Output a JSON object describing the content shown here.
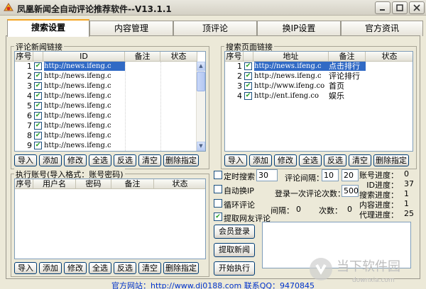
{
  "window": {
    "title": "凤凰新闻全自动评论推荐软件--V13.1.1"
  },
  "tabs": [
    {
      "label": "搜索设置",
      "active": true
    },
    {
      "label": "内容管理",
      "active": false
    },
    {
      "label": "顶评论",
      "active": false
    },
    {
      "label": "换IP设置",
      "active": false
    },
    {
      "label": "官方资讯",
      "active": false
    }
  ],
  "comment_links": {
    "title": "评论新闻链接",
    "headers": [
      "序号",
      "ID",
      "备注",
      "状态"
    ],
    "rows": [
      {
        "num": "1",
        "id": "http://news.ifeng.c",
        "note": "",
        "status": "",
        "checked": true
      },
      {
        "num": "2",
        "id": "http://news.ifeng.c",
        "note": "",
        "status": "",
        "checked": true
      },
      {
        "num": "3",
        "id": "http://news.ifeng.c",
        "note": "",
        "status": "",
        "checked": true
      },
      {
        "num": "4",
        "id": "http://news.ifeng.c",
        "note": "",
        "status": "",
        "checked": true
      },
      {
        "num": "5",
        "id": "http://news.ifeng.c",
        "note": "",
        "status": "",
        "checked": true
      },
      {
        "num": "6",
        "id": "http://news.ifeng.c",
        "note": "",
        "status": "",
        "checked": true
      },
      {
        "num": "7",
        "id": "http://news.ifeng.c",
        "note": "",
        "status": "",
        "checked": true
      },
      {
        "num": "8",
        "id": "http://news.ifeng.c",
        "note": "",
        "status": "",
        "checked": true
      },
      {
        "num": "9",
        "id": "http://news.ifeng.c",
        "note": "",
        "status": "",
        "checked": true
      }
    ]
  },
  "search_links": {
    "title": "搜索页面链接",
    "headers": [
      "序号",
      "地址",
      "备注",
      "状态"
    ],
    "rows": [
      {
        "num": "1",
        "addr": "http://news.ifeng.c",
        "note": "点击排行",
        "status": "",
        "checked": true
      },
      {
        "num": "2",
        "addr": "http://news.ifeng.c",
        "note": "评论排行",
        "status": "",
        "checked": true
      },
      {
        "num": "3",
        "addr": "http://www.ifeng.co",
        "note": "首页",
        "status": "",
        "checked": true
      },
      {
        "num": "4",
        "addr": "http://ent.ifeng.co",
        "note": "娱乐",
        "status": "",
        "checked": true
      }
    ]
  },
  "accounts": {
    "title": "执行账号(导入格式：账号密码)",
    "headers": [
      "序号",
      "用户名",
      "密码",
      "备注",
      "状态"
    ]
  },
  "buttons": [
    "导入",
    "添加",
    "修改",
    "全选",
    "反选",
    "清空",
    "删除指定"
  ],
  "settings": {
    "timed_search": {
      "label": "定时搜索",
      "value": "30",
      "checked": false
    },
    "auto_ip": {
      "label": "自动换IP",
      "checked": false
    },
    "loop_comment": {
      "label": "循环评论",
      "checked": false
    },
    "fetch_comments": {
      "label": "提取网友评论",
      "checked": true
    },
    "comment_interval_label": "评论间隔：",
    "interval_min": "10",
    "interval_max": "20",
    "login_count_label": "登录一次评论次数：",
    "login_count": "500",
    "interval_label": "间隔：",
    "interval_value": "0",
    "times_label": "次数：",
    "times_value": "0"
  },
  "progress": [
    {
      "label": "账号进度：",
      "value": "0"
    },
    {
      "label": "ID进度：",
      "value": "37"
    },
    {
      "label": "搜索进度：",
      "value": "1"
    },
    {
      "label": "内容进度：",
      "value": "1"
    },
    {
      "label": "代理进度：",
      "value": "25"
    }
  ],
  "actions": {
    "login": "会员登录",
    "fetch_news": "提取新闻",
    "start": "开始执行"
  },
  "footer": "官方网站：http://www.dj0188.com 联系QQ：9470845",
  "watermark": {
    "name": "当下软件园",
    "url": "downxia.com"
  },
  "colors": {
    "selection": "#316ac5",
    "tab_accent": "#f5a623",
    "footer_link": "#0033cc"
  }
}
